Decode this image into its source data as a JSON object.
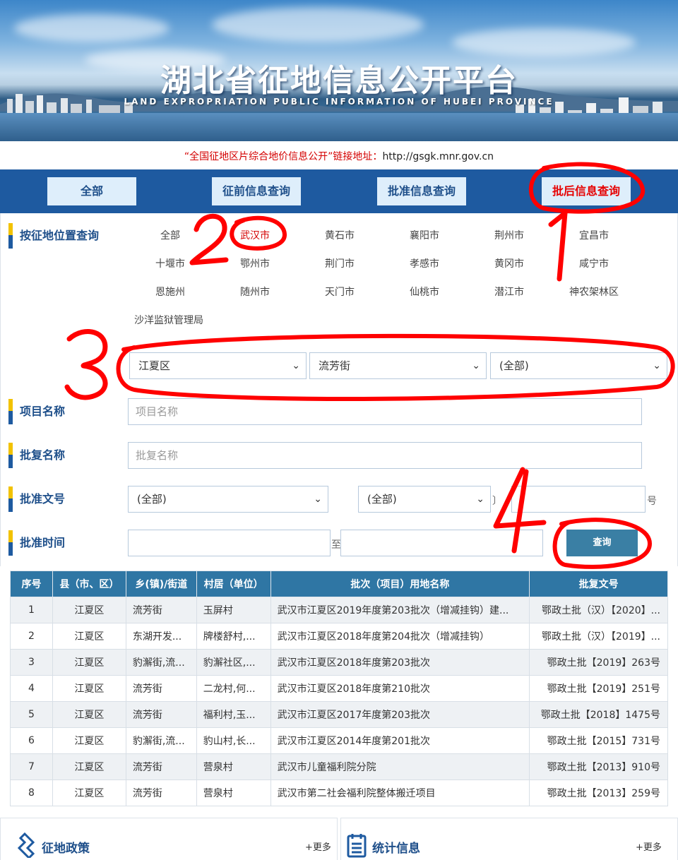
{
  "banner": {
    "title": "湖北省征地信息公开平台",
    "subtitle": "LAND EXPROPRIATION PUBLIC INFORMATION OF HUBEI PROVINCE"
  },
  "link": {
    "text": "“全国征地区片综合地价信息公开”链接地址：",
    "url": "http://gsgk.mnr.gov.cn"
  },
  "tabs": [
    "全部",
    "征前信息查询",
    "批准信息查询",
    "批后信息查询"
  ],
  "filters": {
    "location_label": "按征地位置查询",
    "cities": [
      "全部",
      "武汉市",
      "黄石市",
      "襄阳市",
      "荆州市",
      "宜昌市",
      "十堰市",
      "鄂州市",
      "荆门市",
      "孝感市",
      "黄冈市",
      "咸宁市",
      "恩施州",
      "随州市",
      "天门市",
      "仙桃市",
      "潜江市",
      "神农架林区",
      "沙洋监狱管理局"
    ],
    "district": "江夏区",
    "street": "流芳街",
    "village": "(全部)",
    "project_label": "项目名称",
    "project_placeholder": "项目名称",
    "reply_label": "批复名称",
    "reply_placeholder": "批复名称",
    "docno_label": "批准文号",
    "docno_select1": "(全部)",
    "docno_bracket_open": "〔",
    "docno_select2": "(全部)",
    "docno_bracket_close": "〕",
    "docno_suffix": "号",
    "time_label": "批准时间",
    "time_to": "至",
    "query_button": "查询"
  },
  "table": {
    "headers": [
      "序号",
      "县（市、区）",
      "乡(镇)/街道",
      "村居（单位）",
      "批次（项目）用地名称",
      "批复文号"
    ],
    "rows": [
      [
        "1",
        "江夏区",
        "流芳街",
        "玉屏村",
        "武汉市江夏区2019年度第203批次（增减挂钩）建...",
        "鄂政土批（汉）【2020】..."
      ],
      [
        "2",
        "江夏区",
        "东湖开发...",
        "牌楼舒村,...",
        "武汉市江夏区2018年度第204批次（增减挂钩）",
        "鄂政土批（汉）【2019】..."
      ],
      [
        "3",
        "江夏区",
        "豹澥街,流...",
        "豹澥社区,...",
        "武汉市江夏区2018年度第203批次",
        "鄂政土批【2019】263号"
      ],
      [
        "4",
        "江夏区",
        "流芳街",
        "二龙村,何...",
        "武汉市江夏区2018年度第210批次",
        "鄂政土批【2019】251号"
      ],
      [
        "5",
        "江夏区",
        "流芳街",
        "福利村,玉...",
        "武汉市江夏区2017年度第203批次",
        "鄂政土批【2018】1475号"
      ],
      [
        "6",
        "江夏区",
        "豹澥街,流...",
        "豹山村,长...",
        "武汉市江夏区2014年度第201批次",
        "鄂政土批【2015】731号"
      ],
      [
        "7",
        "江夏区",
        "流芳街",
        "营泉村",
        "武汉市儿童福利院分院",
        "鄂政土批【2013】910号"
      ],
      [
        "8",
        "江夏区",
        "流芳街",
        "营泉村",
        "武汉市第二社会福利院整体搬迁项目",
        "鄂政土批【2013】259号"
      ]
    ]
  },
  "footer": {
    "policy_title": "征地政策",
    "policy_more": "+更多",
    "stats_title": "统计信息",
    "stats_more": "+更多"
  },
  "annotations": [
    "1",
    "2",
    "3",
    "4"
  ],
  "colors": {
    "nav_blue": "#1e5aa0",
    "table_header": "#2f76a4",
    "active_red": "#e60000",
    "query_button": "#3a7fa4",
    "annotation_red": "#ff0000"
  }
}
